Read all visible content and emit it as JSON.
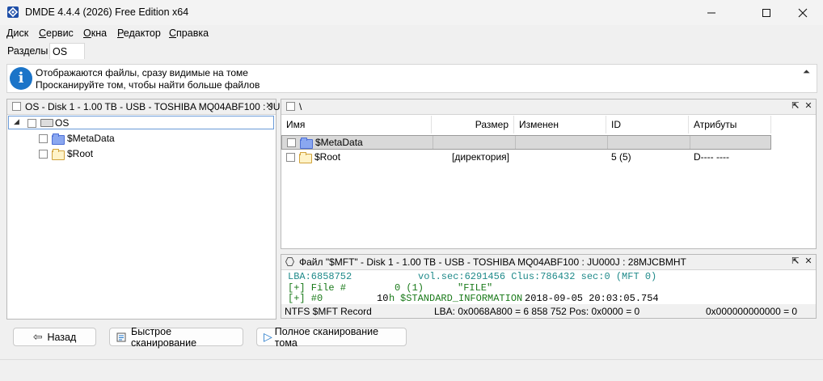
{
  "window": {
    "title": "DMDE 4.4.4 (2026) Free Edition x64",
    "minimize_glyph": "—",
    "maximize_glyph": "☐",
    "close_glyph": "✕"
  },
  "menu": [
    "Диск",
    "Сервис",
    "Окна",
    "Редактор",
    "Справка"
  ],
  "tabs": [
    "Разделы",
    "OS"
  ],
  "info": {
    "icon_glyph": "i",
    "line1": "Отображаются файлы, сразу видимые на томе",
    "line2": "Просканируйте том, чтобы найти больше файлов",
    "collapse_glyph": "⏶"
  },
  "tree": {
    "header": "OS - Disk 1 - 1.00 TB - USB - TOSHIBA MQ04ABF100 : JU...",
    "close_glyph": "✕",
    "root": {
      "expander": "◢",
      "label": "OS"
    },
    "children": [
      "$MetaData",
      "$Root"
    ]
  },
  "files": {
    "path": "\\",
    "columns": [
      "Имя",
      "Размер",
      "Изменен",
      "ID",
      "Атрибуты"
    ],
    "rows": [
      {
        "name": "$MetaData",
        "size": "",
        "modified": "",
        "id": "",
        "attr": ""
      },
      {
        "name": "$Root",
        "size": "[директория]",
        "modified": "",
        "id": "5 (5)",
        "attr": "D---- ----"
      }
    ],
    "expand_glyph": "⇱",
    "close_glyph": "✕"
  },
  "record": {
    "header": "Файл \"$MFT\" - Disk 1 - 1.00 TB - USB - TOSHIBA MQ04ABF100 : JU000J : 28MJCBMHT",
    "line1_a": "LBA:6858752",
    "line1_b": "vol.sec:6291456 Clus:786432 sec:0 (MFT 0)",
    "line2_a": "[+] File #",
    "line2_b": "0 (1)",
    "line2_c": "\"FILE\"",
    "line3_a": "[+] #0",
    "line3_b": "10",
    "line3_c": "h",
    "line3_d": "$STANDARD_INFORMATION",
    "line3_e": "2018-09-05 20:03:05.754",
    "status_type": "NTFS $MFT Record",
    "status_lba": "LBA: 0x0068A800 = 6 858 752  Pos: 0x0000 = 0",
    "status_value": "0x000000000000 = 0",
    "expand_glyph": "⇱",
    "close_glyph": "✕"
  },
  "buttons": {
    "back": "Назад",
    "back_glyph": "⇦",
    "quick_scan": "Быстрое сканирование",
    "full_scan": "Полное сканирование тома",
    "full_scan_glyph": "▷"
  },
  "colors": {
    "accent": "#1b74c8",
    "mono_teal": "#1f8a8a",
    "mono_green": "#1a7a1a",
    "selection": "#d9d9d9"
  }
}
